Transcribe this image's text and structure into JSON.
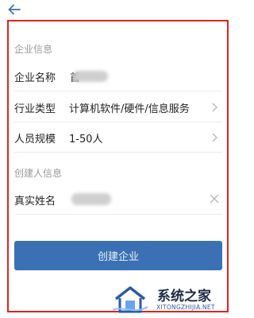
{
  "header": {
    "back_icon": "arrow-left-icon"
  },
  "company_section": {
    "heading": "企业信息",
    "rows": [
      {
        "label": "企业名称",
        "value": "首",
        "value_redacted": true
      },
      {
        "label": "行业类型",
        "value": "计算机软件/硬件/信息服务",
        "icon": "chevron-right-icon"
      },
      {
        "label": "人员规模",
        "value": "1-50人",
        "icon": "chevron-right-icon"
      }
    ]
  },
  "creator_section": {
    "heading": "创建人信息",
    "rows": [
      {
        "label": "真实姓名",
        "value_redacted": true,
        "icon": "clear-x-icon"
      }
    ]
  },
  "submit": {
    "label": "创建企业"
  },
  "colors": {
    "accent": "#3b71b4",
    "highlight_border": "#e0231b",
    "watermark_text": "#1f2a44"
  },
  "watermark": {
    "title": "系统之家",
    "url": "XITONGZHIJIA.NET"
  }
}
